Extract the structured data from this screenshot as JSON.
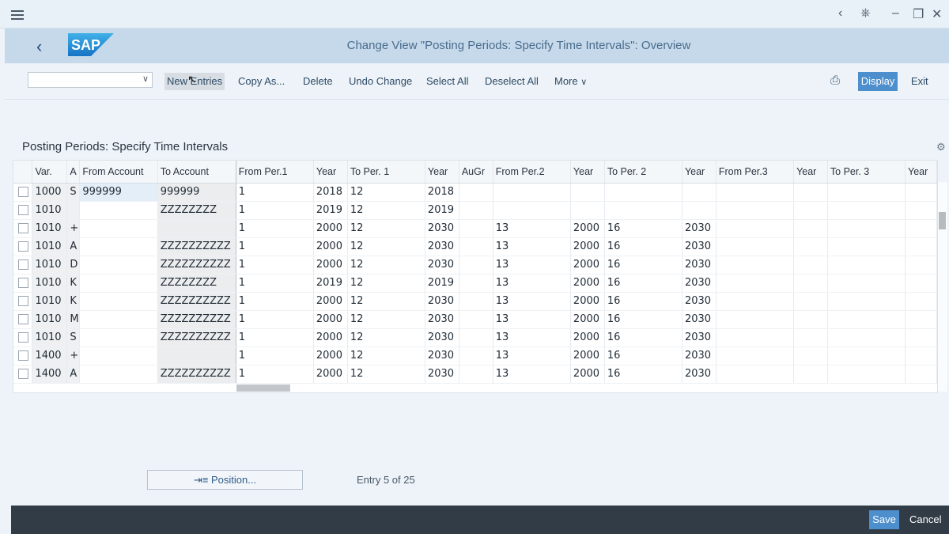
{
  "window": {
    "controls": [
      "‹",
      "⎈",
      "–",
      "❐",
      "✕"
    ]
  },
  "header": {
    "logo_text": "SAP",
    "title": "Change View \"Posting Periods: Specify Time Intervals\": Overview"
  },
  "toolbar": {
    "variant_value": "",
    "new_entries": "New Entries",
    "copy_as": "Copy As...",
    "delete": "Delete",
    "undo_change": "Undo Change",
    "select_all": "Select All",
    "deselect_all": "Deselect All",
    "more": "More",
    "display": "Display",
    "exit": "Exit"
  },
  "section": {
    "title": "Posting Periods: Specify Time Intervals"
  },
  "table": {
    "columns": [
      "",
      "Var.",
      "A",
      "From Account",
      "To Account",
      "From Per.1",
      "Year",
      "To Per. 1",
      "Year",
      "AuGr",
      "From Per.2",
      "Year",
      "To Per. 2",
      "Year",
      "From Per.3",
      "Year",
      "To Per. 3",
      "Year"
    ],
    "rows": [
      [
        "1000",
        "S",
        "999999",
        "999999",
        "1",
        "2018",
        "12",
        "2018",
        "",
        "",
        "",
        "",
        ""
      ],
      [
        "1010",
        "",
        "",
        "ZZZZZZZZ",
        "1",
        "2019",
        "12",
        "2019",
        "",
        "",
        "",
        "",
        ""
      ],
      [
        "1010",
        "+",
        "",
        "",
        "1",
        "2000",
        "12",
        "2030",
        "",
        "13",
        "2000",
        "16",
        "2030"
      ],
      [
        "1010",
        "A",
        "",
        "ZZZZZZZZZZ",
        "1",
        "2000",
        "12",
        "2030",
        "",
        "13",
        "2000",
        "16",
        "2030"
      ],
      [
        "1010",
        "D",
        "",
        "ZZZZZZZZZZ",
        "1",
        "2000",
        "12",
        "2030",
        "",
        "13",
        "2000",
        "16",
        "2030"
      ],
      [
        "1010",
        "K",
        "",
        "ZZZZZZZZ",
        "1",
        "2019",
        "12",
        "2019",
        "",
        "13",
        "2000",
        "16",
        "2030"
      ],
      [
        "1010",
        "K",
        "",
        "ZZZZZZZZZZ",
        "1",
        "2000",
        "12",
        "2030",
        "",
        "13",
        "2000",
        "16",
        "2030"
      ],
      [
        "1010",
        "M",
        "",
        "ZZZZZZZZZZ",
        "1",
        "2000",
        "12",
        "2030",
        "",
        "13",
        "2000",
        "16",
        "2030"
      ],
      [
        "1010",
        "S",
        "",
        "ZZZZZZZZZZ",
        "1",
        "2000",
        "12",
        "2030",
        "",
        "13",
        "2000",
        "16",
        "2030"
      ],
      [
        "1400",
        "+",
        "",
        "",
        "1",
        "2000",
        "12",
        "2030",
        "",
        "13",
        "2000",
        "16",
        "2030"
      ],
      [
        "1400",
        "A",
        "",
        "ZZZZZZZZZZ",
        "1",
        "2000",
        "12",
        "2030",
        "",
        "13",
        "2000",
        "16",
        "2030"
      ]
    ]
  },
  "pager": {
    "position_label": "Position...",
    "entry_info": "Entry 5 of 25"
  },
  "footer": {
    "save": "Save",
    "cancel": "Cancel"
  },
  "colors": {
    "accent": "#4d8fcd",
    "shell": "#c5d9ea",
    "footer": "#323c46"
  }
}
